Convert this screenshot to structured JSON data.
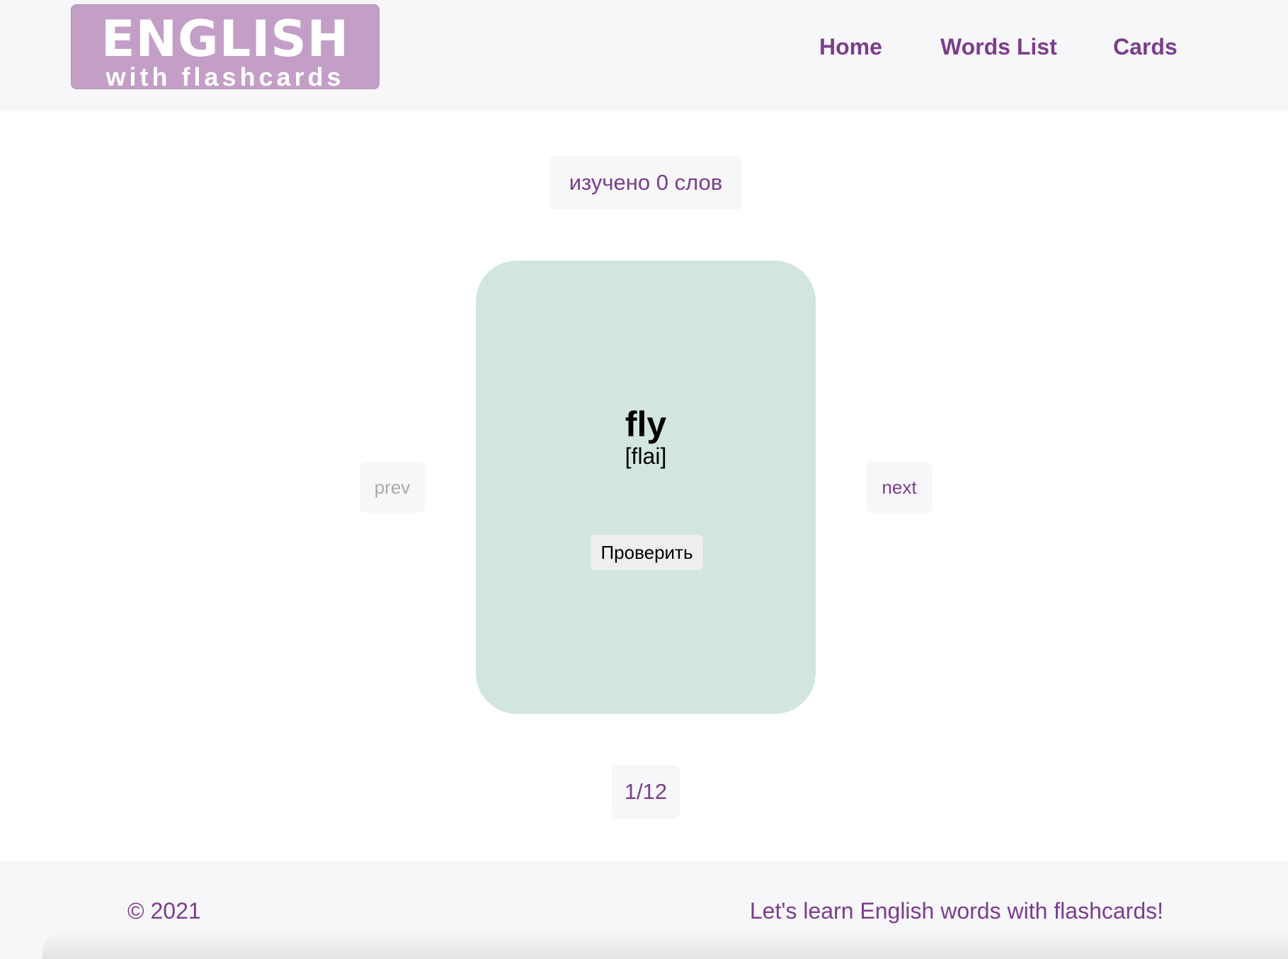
{
  "header": {
    "logo": {
      "title": "ENGLISH",
      "subtitle": "with flashcards"
    },
    "nav": {
      "home": "Home",
      "words_list": "Words List",
      "cards": "Cards"
    }
  },
  "progress": {
    "learned_text": "изучено 0 слов"
  },
  "card": {
    "word": "fly",
    "transcription": "[flai]",
    "check_label": "Проверить"
  },
  "navigation": {
    "prev_label": "prev",
    "next_label": "next",
    "counter": "1/12"
  },
  "footer": {
    "copyright": "© 2021",
    "tagline": "Let's learn English words with flashcards!"
  },
  "colors": {
    "accent": "#7b3d8c",
    "logo_bg": "#c39fc7",
    "card_bg": "#d2e6df",
    "panel_bg": "#f7f7f9",
    "disabled_text": "#aaaaaa"
  }
}
